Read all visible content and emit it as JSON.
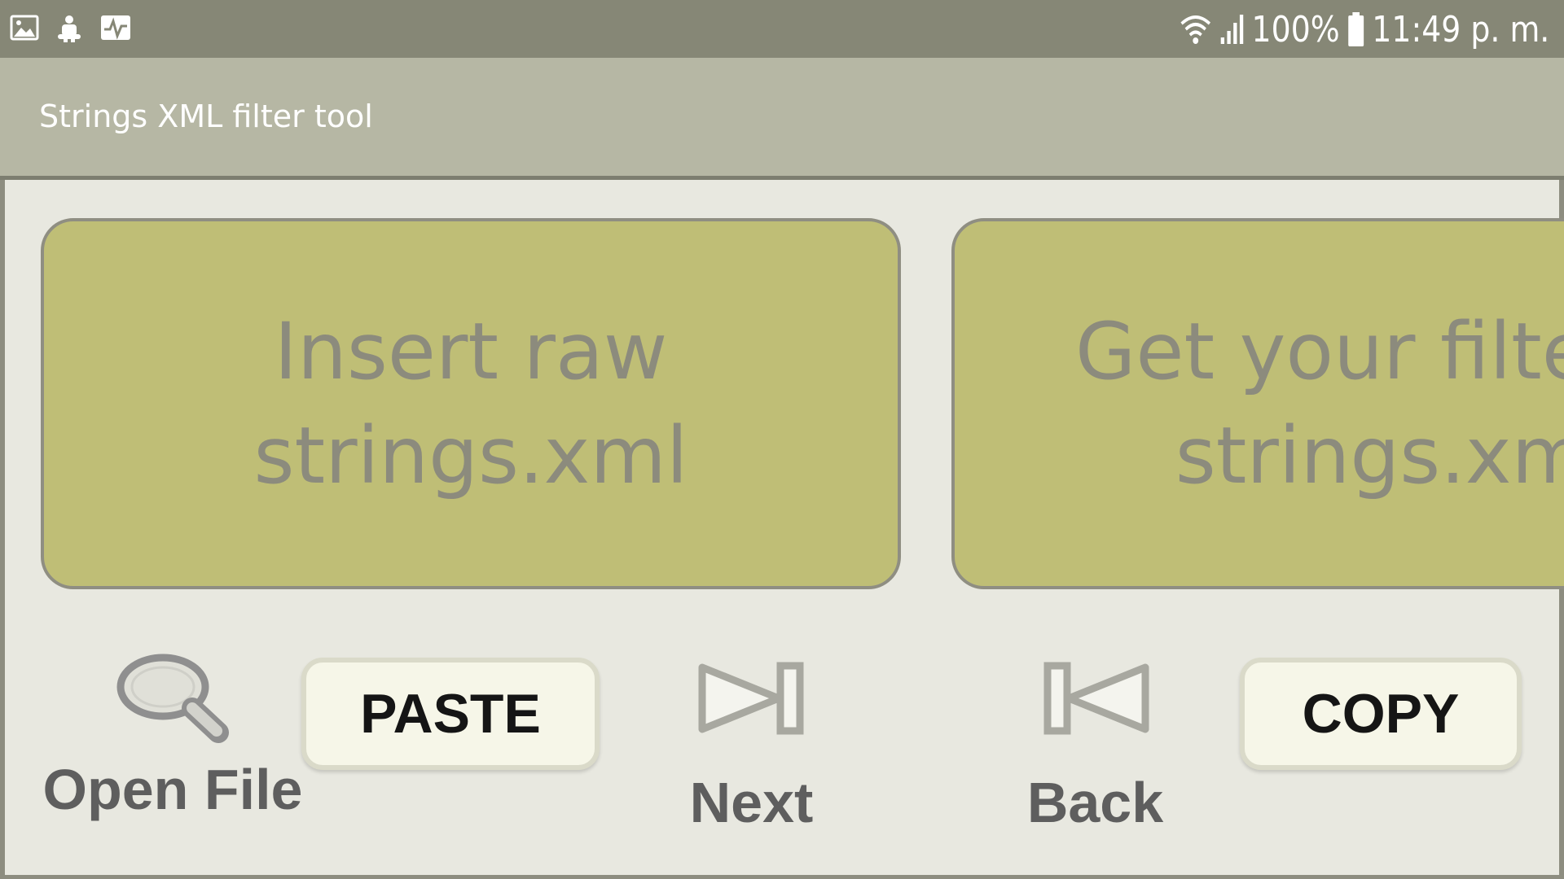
{
  "status_bar": {
    "left_icons": [
      "gallery-icon",
      "android-debug-icon",
      "activity-icon"
    ],
    "battery_percent": "100%",
    "time": "11:49 p. m."
  },
  "app_bar": {
    "title": "Strings XML filter tool"
  },
  "panels": [
    {
      "text": "Insert raw\nstrings.xml"
    },
    {
      "line1": "Get your filte",
      "line2": "strings.xm"
    }
  ],
  "buttons": {
    "open_file": "Open File",
    "paste": "PASTE",
    "next": "Next",
    "back": "Back",
    "copy": "COPY"
  },
  "colors": {
    "status_bar": "#868776",
    "app_bar": "#b6b7a4",
    "panel": "#bfbe76",
    "background": "#e8e8e0"
  }
}
